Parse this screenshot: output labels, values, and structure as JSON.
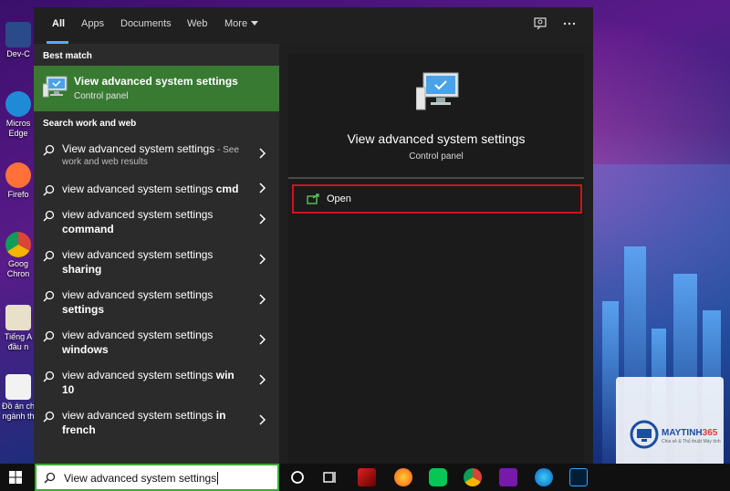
{
  "tabs": {
    "all": "All",
    "apps": "Apps",
    "documents": "Documents",
    "web": "Web",
    "more": "More"
  },
  "left": {
    "best_match_label": "Best match",
    "best_match": {
      "title": "View advanced system settings",
      "subtitle": "Control panel"
    },
    "search_web_label": "Search work and web",
    "results": [
      {
        "line1": "View advanced system settings",
        "suffix": " - See",
        "line2": "work and web results"
      },
      {
        "line1": "view advanced system settings ",
        "bold": "cmd"
      },
      {
        "line1": "view advanced system settings",
        "line2_bold": "command"
      },
      {
        "line1": "view advanced system settings",
        "line2_bold": "sharing"
      },
      {
        "line1": "view advanced system settings",
        "line2_bold": "settings"
      },
      {
        "line1": "view advanced system settings",
        "line2_bold": "windows"
      },
      {
        "line1": "view advanced system settings ",
        "bold": "win",
        "line2_bold": "10"
      },
      {
        "line1": "view advanced system settings ",
        "bold": "in",
        "line2_bold": "french"
      }
    ]
  },
  "right": {
    "title": "View advanced system settings",
    "subtitle": "Control panel",
    "open_label": "Open"
  },
  "search": {
    "value": "View advanced system settings"
  },
  "desktop_icons": [
    "Dev-C",
    "Micros Edge",
    "Firefo",
    "Goog Chron",
    "Tiếng A đầu n",
    "Đồ án ch ngành th"
  ],
  "watermark": {
    "brand": "MAYTINH",
    "brand_num": "365",
    "tag": "Chia sẻ & Thủ thuật Máy tính"
  },
  "colors": {
    "best_match_bg": "#387a32",
    "highlight": "#d0141b",
    "search_border": "#3ea83a",
    "tab_underline": "#5ba8ff"
  }
}
